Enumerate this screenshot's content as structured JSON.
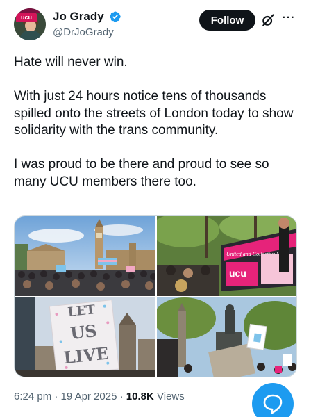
{
  "author": {
    "display_name": "Jo Grady",
    "handle": "@DrJoGrady",
    "avatar_badge": "ucu",
    "verified_color": "#1d9bf0"
  },
  "actions": {
    "follow_label": "Follow",
    "grok_icon": "grok-icon",
    "more_icon": "more-icon",
    "more_label": "···"
  },
  "tweet": {
    "paragraphs": [
      "Hate will never win.",
      "With just 24 hours notice tens of thousands spilled onto the streets of London today to show solidarity with the trans community.",
      "I was proud to be there and proud to see so many UCU members there too."
    ]
  },
  "media": {
    "photos": [
      "photo-1",
      "photo-2",
      "photo-3",
      "photo-4"
    ],
    "banner_text": "United and Collective Voi",
    "banner_logo": "ucu",
    "sign_text": [
      "LET",
      "US",
      "LIVE"
    ]
  },
  "meta": {
    "time": "6:24 pm",
    "separator": " · ",
    "date": "19 Apr 2025",
    "views_count": "10.8K",
    "views_label": "Views"
  },
  "colors": {
    "accent": "#1d9bf0",
    "text": "#0f1419",
    "muted": "#536471"
  }
}
